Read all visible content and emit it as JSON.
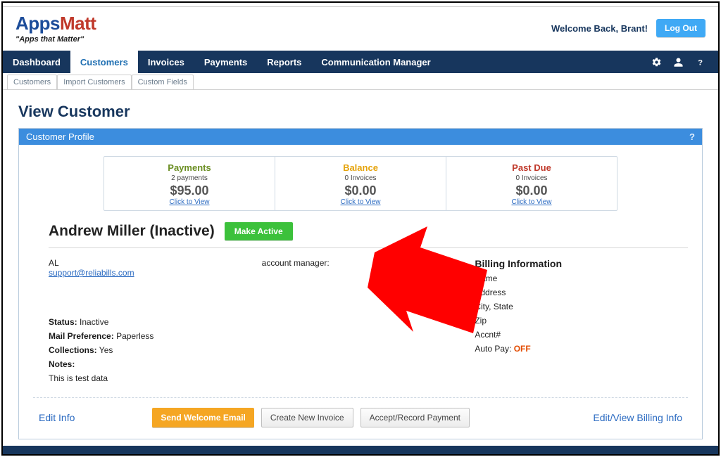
{
  "header": {
    "logo_apps": "Apps",
    "logo_matt": "Matt",
    "tagline": "\"Apps that Matter\"",
    "welcome": "Welcome Back, Brant!",
    "logout": "Log Out"
  },
  "nav": {
    "items": [
      "Dashboard",
      "Customers",
      "Invoices",
      "Payments",
      "Reports",
      "Communication Manager"
    ],
    "active_index": 1
  },
  "subnav": {
    "items": [
      "Customers",
      "Import Customers",
      "Custom Fields"
    ]
  },
  "page": {
    "title": "View Customer",
    "panel_title": "Customer Profile"
  },
  "metrics": {
    "payments": {
      "title": "Payments",
      "sub": "2 payments",
      "amount": "$95.00",
      "link": "Click to View"
    },
    "balance": {
      "title": "Balance",
      "sub": "0 Invoices",
      "amount": "$0.00",
      "link": "Click to View"
    },
    "pastdue": {
      "title": "Past Due",
      "sub": "0 Invoices",
      "amount": "$0.00",
      "link": "Click to View"
    }
  },
  "customer": {
    "name": "Andrew Miller (Inactive)",
    "make_active": "Make Active",
    "code": "AL",
    "email": "support@reliabills.com",
    "acct_mgr_label": "account manager:",
    "status_label": "Status:",
    "status_value": "Inactive",
    "mail_pref_label": "Mail Preference:",
    "mail_pref_value": "Paperless",
    "collections_label": "Collections:",
    "collections_value": "Yes",
    "notes_label": "Notes:",
    "notes_value": "This is test data"
  },
  "billing": {
    "heading": "Billing Information",
    "name": "Name",
    "address": "Address",
    "city_state": "City, State",
    "zip": "Zip",
    "acct": "Accnt#",
    "autopay_label": "Auto Pay:",
    "autopay_value": "OFF"
  },
  "footer": {
    "edit_info": "Edit Info",
    "send_welcome": "Send Welcome Email",
    "create_invoice": "Create New Invoice",
    "accept_payment": "Accept/Record Payment",
    "edit_billing": "Edit/View Billing Info"
  }
}
